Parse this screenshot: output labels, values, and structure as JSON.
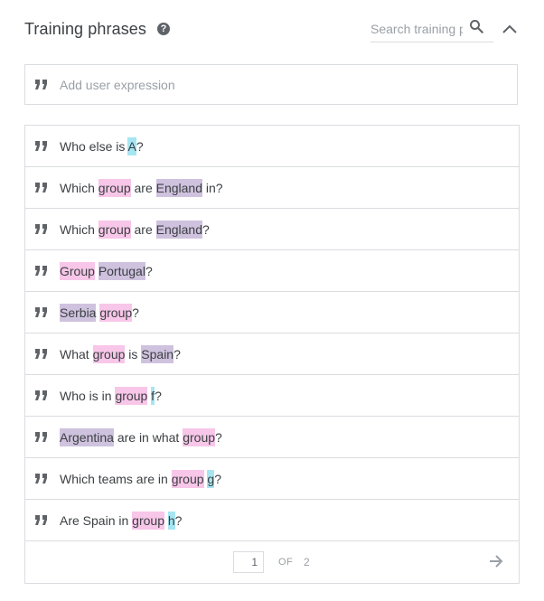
{
  "header": {
    "title": "Training phrases",
    "help_icon": "help-circle-icon",
    "search_placeholder": "Search training phrases",
    "search_value": ""
  },
  "add_expression": {
    "placeholder": "Add user expression",
    "icon": "quote-icon"
  },
  "colors": {
    "entity_group": "#f7c6e8",
    "entity_country": "#cfc2de",
    "entity_letter": "#a6e6f2",
    "border": "#dadce0",
    "text": "#3c4043"
  },
  "phrases": [
    {
      "segments": [
        {
          "text": "Who else is "
        },
        {
          "text": "A",
          "hl": "cyan"
        },
        {
          "text": "?"
        }
      ]
    },
    {
      "segments": [
        {
          "text": "Which "
        },
        {
          "text": "group",
          "hl": "pink"
        },
        {
          "text": " are "
        },
        {
          "text": "England",
          "hl": "purple"
        },
        {
          "text": " in?"
        }
      ]
    },
    {
      "segments": [
        {
          "text": "Which "
        },
        {
          "text": "group",
          "hl": "pink"
        },
        {
          "text": " are "
        },
        {
          "text": "England",
          "hl": "purple"
        },
        {
          "text": "?"
        }
      ]
    },
    {
      "segments": [
        {
          "text": "Group",
          "hl": "pink"
        },
        {
          "text": " "
        },
        {
          "text": "Portugal",
          "hl": "purple"
        },
        {
          "text": "?"
        }
      ]
    },
    {
      "segments": [
        {
          "text": "Serbia",
          "hl": "purple"
        },
        {
          "text": " "
        },
        {
          "text": "group",
          "hl": "pink"
        },
        {
          "text": "?"
        }
      ]
    },
    {
      "segments": [
        {
          "text": "What "
        },
        {
          "text": "group",
          "hl": "pink"
        },
        {
          "text": " is "
        },
        {
          "text": "Spain",
          "hl": "purple"
        },
        {
          "text": "?"
        }
      ]
    },
    {
      "segments": [
        {
          "text": "Who is in "
        },
        {
          "text": "group",
          "hl": "pink"
        },
        {
          "text": " "
        },
        {
          "text": "f",
          "hl": "cyan"
        },
        {
          "text": "?"
        }
      ]
    },
    {
      "segments": [
        {
          "text": "Argentina",
          "hl": "purple"
        },
        {
          "text": " are in what "
        },
        {
          "text": "group",
          "hl": "pink"
        },
        {
          "text": "?"
        }
      ]
    },
    {
      "segments": [
        {
          "text": "Which teams are in "
        },
        {
          "text": "group",
          "hl": "pink"
        },
        {
          "text": " "
        },
        {
          "text": "g",
          "hl": "cyan"
        },
        {
          "text": "?"
        }
      ]
    },
    {
      "segments": [
        {
          "text": "Are Spain in "
        },
        {
          "text": "group",
          "hl": "pink"
        },
        {
          "text": " "
        },
        {
          "text": "h",
          "hl": "cyan"
        },
        {
          "text": "?"
        }
      ]
    }
  ],
  "pagination": {
    "current_page": "1",
    "of_label": "OF",
    "total_pages": "2",
    "next_icon": "arrow-right-icon"
  }
}
